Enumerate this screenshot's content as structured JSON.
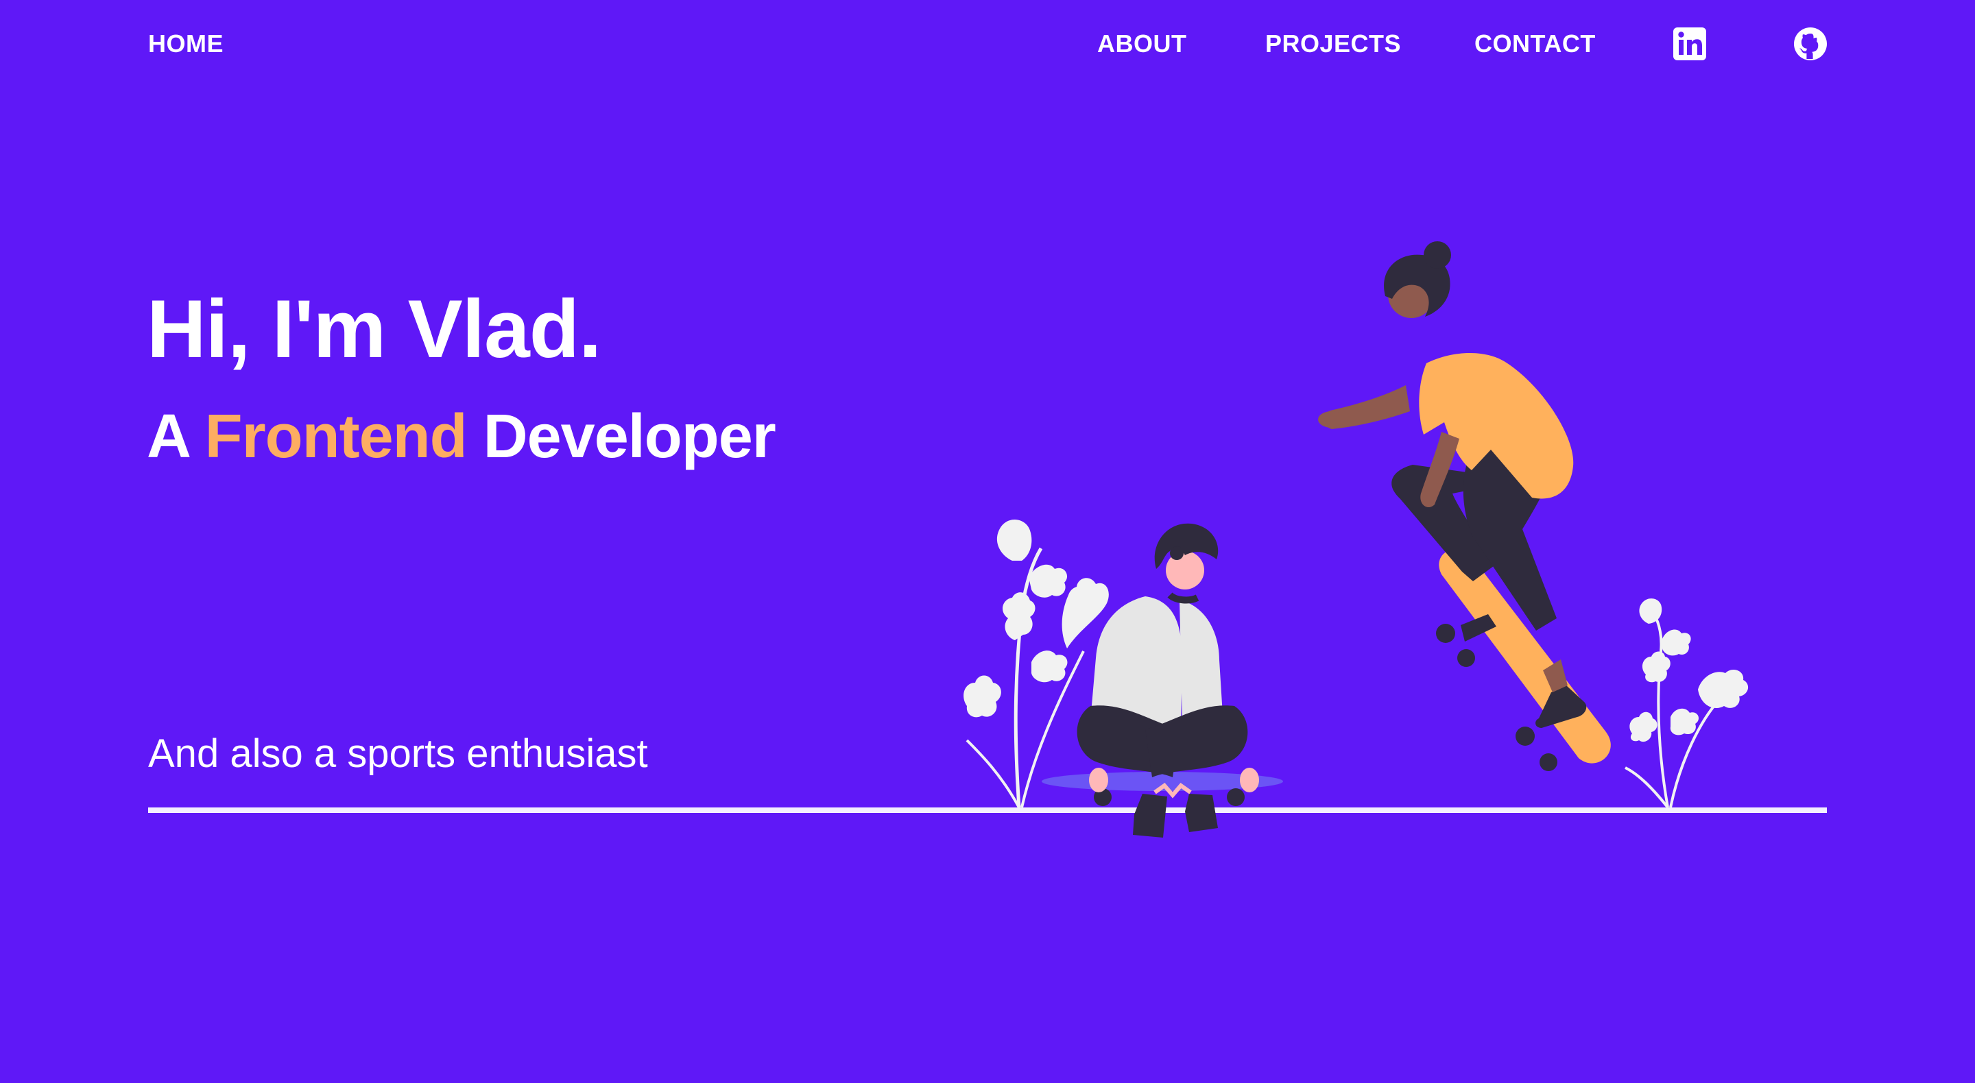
{
  "nav": {
    "home": "HOME",
    "about": "ABOUT",
    "projects": "PROJECTS",
    "contact": "CONTACT",
    "linkedin_icon": "linkedin-icon",
    "github_icon": "github-icon"
  },
  "hero": {
    "title": "Hi, I'm Vlad.",
    "sub_prefix": "A",
    "sub_accent": "Frontend",
    "sub_suffix": "Developer",
    "tagline": "And also a sports enthusiast"
  },
  "colors": {
    "background": "#5f18f7",
    "accent": "#fdad62",
    "text": "#ffffff",
    "dark": "#2f2b3d",
    "skin_dark": "#8f5a4e",
    "skin_light": "#ffb8b8",
    "shirt_light": "#e6e6e6",
    "skateboard": "#ffb15c"
  }
}
